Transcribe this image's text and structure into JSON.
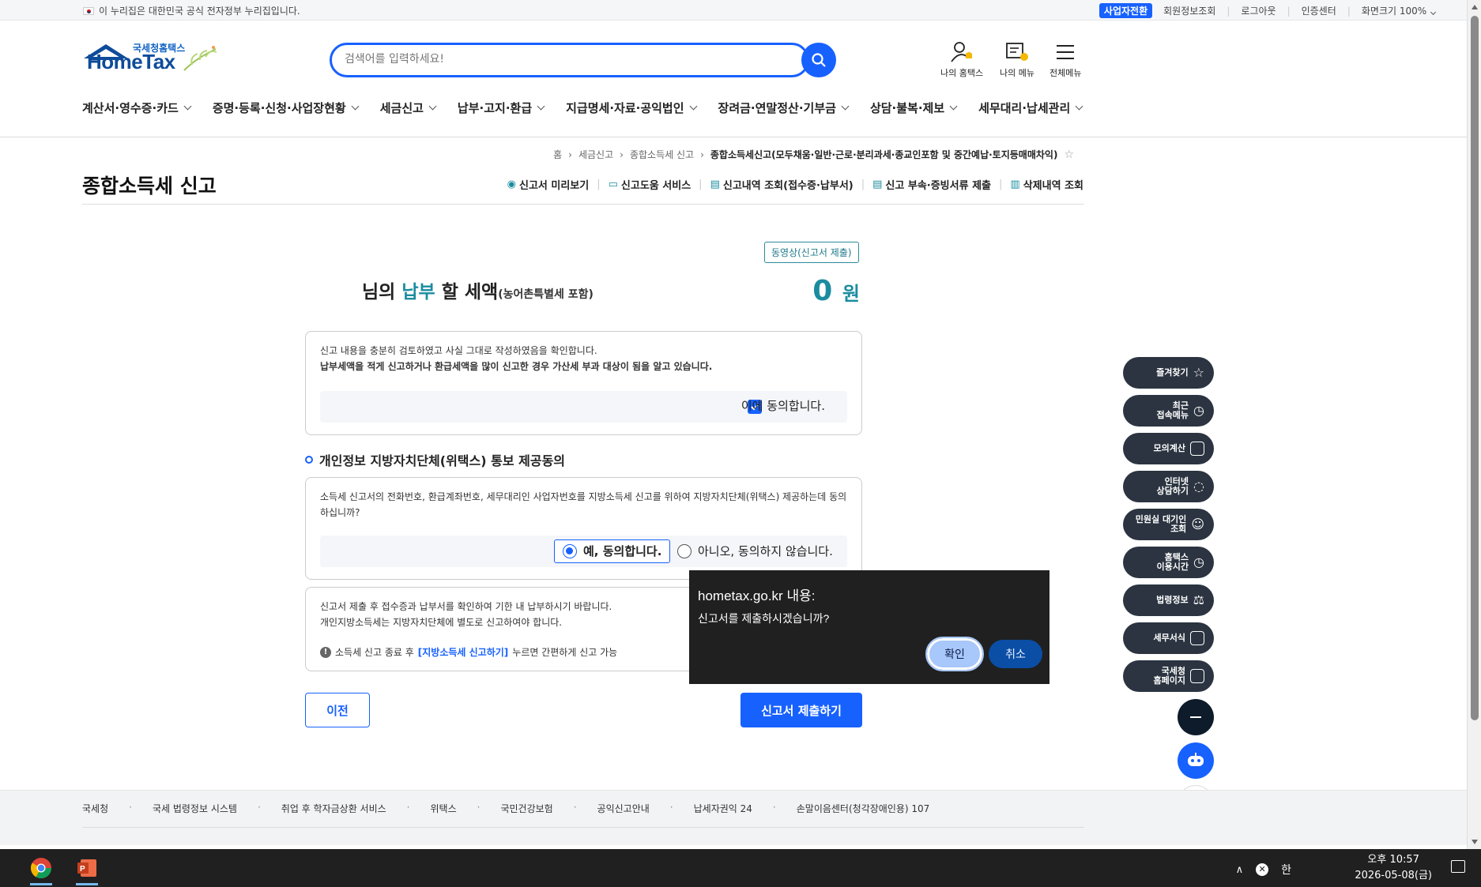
{
  "topbar": {
    "gov_notice": "이 누리집은 대한민국 공식 전자정부 누리집입니다.",
    "biz_switch": "사업자전환",
    "links": [
      "회원정보조회",
      "로그아웃",
      "인증센터"
    ],
    "screen_size_label": "화면크기",
    "screen_size_value": "100%"
  },
  "header": {
    "logo_small": "국세청홈택스",
    "logo_big": "HomeTax",
    "search_placeholder": "검색어를 입력하세요!",
    "icons": [
      "나의 홈택스",
      "나의 메뉴",
      "전체메뉴"
    ],
    "nav": [
      "계산서·영수증·카드",
      "증명·등록·신청·사업장현황",
      "세금신고",
      "납부·고지·환급",
      "지급명세·자료·공익법인",
      "장려금·연말정산·기부금",
      "상담·불복·제보",
      "세무대리·납세관리"
    ]
  },
  "breadcrumb": [
    "홈",
    "세금신고",
    "종합소득세 신고",
    "종합소득세신고(모두채움·일반·근로·분리과세·종교인포함 및 중간예납·토지등매매차익)"
  ],
  "page": {
    "title": "종합소득세 신고",
    "subnav": [
      "신고서 미리보기",
      "신고도움 서비스",
      "신고내역 조회(접수증·납부서)",
      "신고 부속·증빙서류 제출",
      "삭제내역 조회"
    ]
  },
  "main": {
    "video_button": "동영상(신고서 제출)",
    "tax_prefix": "님의",
    "tax_highlight": "납부",
    "tax_suffix": "할 세액",
    "tax_note": "(농어촌특별세 포함)",
    "amount": "0",
    "amount_unit": "원",
    "confirm_line1": "신고 내용을 충분히 검토하였고 사실 그대로 작성하였음을 확인합니다.",
    "confirm_line2": "납부세액을 적게 신고하거나 환급세액을 많이 신고한 경우 가산세 부과 대상이 됨을 알고 있습니다.",
    "agree_label": "이에 동의합니다.",
    "agree_checked": true,
    "privacy_title": "개인정보 지방자치단체(위택스) 통보 제공동의",
    "privacy_text": "소득세 신고서의 전화번호, 환급계좌번호, 세무대리인 사업자번호를 지방소득세 신고를 위하여 지방자치단체(위택스) 제공하는데 동의하십니까?",
    "radio_yes": "예, 동의합니다.",
    "radio_no": "아니오, 동의하지 않습니다.",
    "notice_line1": "신고서 제출 후 접수증과 납부서를 확인하여 기한 내 납부하시기 바랍니다.",
    "notice_line2": "개인지방소득세는 지방자치단체에 별도로 신고하여야 합니다.",
    "note_prefix": "소득세 신고 종료 후",
    "note_link": "[지방소득세 신고하기]",
    "note_suffix": "누르면 간편하게 신고 가능",
    "prev_button": "이전",
    "submit_button": "신고서 제출하기"
  },
  "dialog": {
    "title": "hometax.go.kr 내용:",
    "message": "신고서를 제출하시겠습니까?",
    "ok": "확인",
    "cancel": "취소"
  },
  "quick_menu": [
    "즐겨찾기",
    "최근\n접속메뉴",
    "모의계산",
    "인터넷\n상담하기",
    "민원실 대기인\n조회",
    "홈택스\n이용시간",
    "법령정보",
    "세무서식",
    "국세청\n홈페이지"
  ],
  "footer_links": [
    "국세청",
    "국세 법령정보 시스템",
    "취업 후 학자금상환 서비스",
    "위택스",
    "국민건강보험",
    "공익신고안내",
    "납세자권익 24",
    "손말이음센터(청각장애인용) 107"
  ],
  "taskbar": {
    "time": "오후 10:57",
    "date": "2026-05-08(금)",
    "ime": "한"
  },
  "colors": {
    "primary": "#1761ff",
    "teal": "#1b8ca0",
    "dark_button": "#2b3440"
  }
}
